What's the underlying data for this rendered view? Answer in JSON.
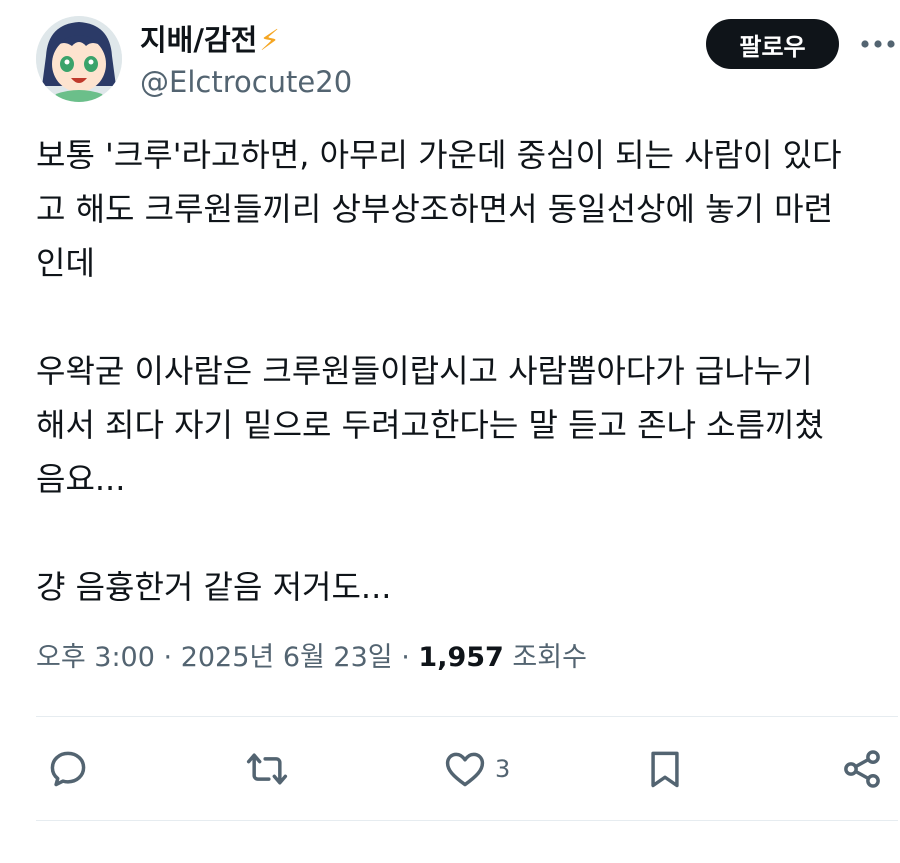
{
  "author": {
    "display_name": "지배/감전",
    "badge_emoji": "⚡",
    "handle": "@Elctrocute20"
  },
  "follow_button": {
    "label": "팔로우"
  },
  "more_icon": "more-horizontal-icon",
  "post": {
    "paragraphs": [
      "보통 '크루'라고하면, 아무리 가운데 중심이 되는 사람이 있다\n고 해도 크루원들끼리 상부상조하면서 동일선상에 놓기 마련\n인데",
      "우왁굳 이사람은 크루원들이랍시고 사람뽑아다가 급나누기\n해서 죄다 자기 밑으로 두려고한다는 말 듣고 존나 소름끼쳤\n음요...",
      "걍 음흉한거 같음 저거도..."
    ]
  },
  "meta": {
    "time": "오후 3:00",
    "separator": "·",
    "date": "2025년 6월 23일",
    "views_count": "1,957",
    "views_label": "조회수"
  },
  "actions": {
    "reply_icon": "reply-icon",
    "repost_icon": "repost-icon",
    "like_icon": "heart-icon",
    "like_count": "3",
    "bookmark_icon": "bookmark-icon",
    "share_icon": "share-icon"
  },
  "colors": {
    "text": "#0f1419",
    "secondary": "#536471",
    "follow_bg": "#0f1419",
    "divider": "#e6ecf0",
    "bolt": "#f5a623"
  }
}
